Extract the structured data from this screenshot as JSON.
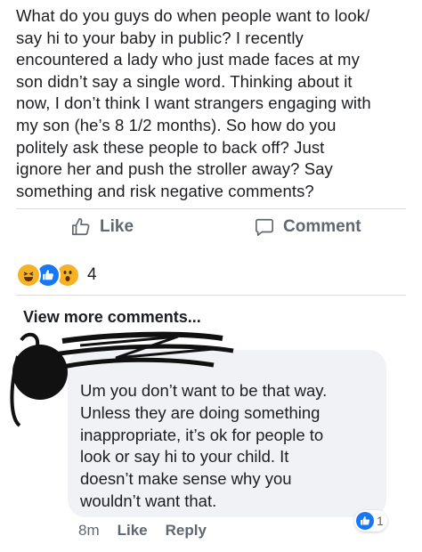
{
  "post": {
    "lines": [
      "What do you guys do when people want to look/",
      "say hi to your baby in public? I recently",
      "encountered a lady who just made faces at my",
      "son didn’t say a single word. Thinking about it",
      "now, I don’t think I want strangers engaging with",
      "my son (he’s 8 1/2 months). So how do you",
      "politely ask these people to back off? Just",
      "ignore her and push the stroller away? Say",
      "something and risk negative comments?"
    ]
  },
  "actions": {
    "like_label": "Like",
    "comment_label": "Comment",
    "like_icon": "thumbs-up-outline-icon",
    "comment_icon": "speech-bubble-icon"
  },
  "reactions": {
    "types": [
      "haha",
      "like",
      "wow"
    ],
    "count": "4"
  },
  "comments": {
    "view_more_label": "View more comments...",
    "items": [
      {
        "author": "",
        "lines": [
          "Um you don’t want to be that way.",
          "Unless they are doing something",
          "inappropriate, it’s ok for people to",
          "look or say hi to your child. It",
          "doesn’t make sense why you",
          "wouldn’t want that."
        ],
        "time": "8m",
        "like_label": "Like",
        "reply_label": "Reply",
        "reaction_count": "1",
        "reaction_type": "like"
      }
    ]
  },
  "colors": {
    "brand_blue": "#1877f2",
    "bubble_bg": "#f0f2f5",
    "meta_gray": "#606770",
    "reaction_yellow": "#f7b125"
  }
}
